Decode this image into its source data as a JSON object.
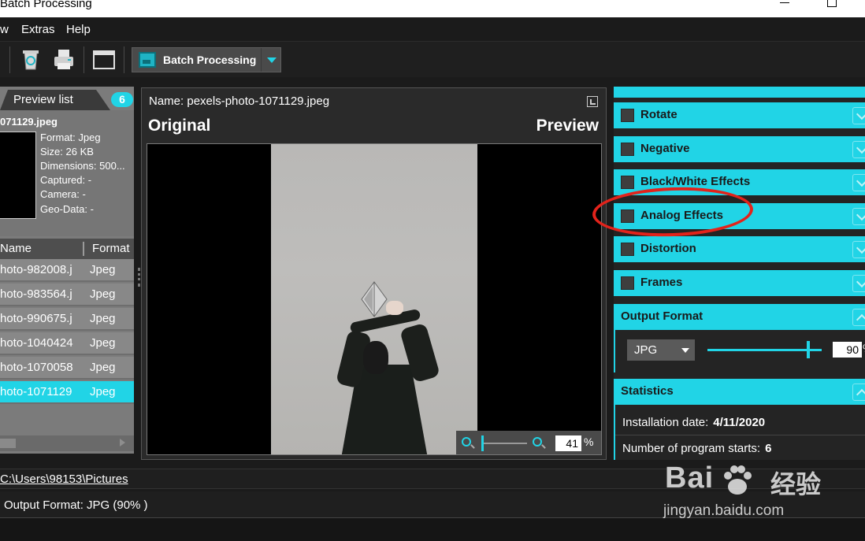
{
  "window": {
    "title": "Batch Processing"
  },
  "menu": [
    {
      "label": "w",
      "x": 0
    },
    {
      "label": "Extras",
      "x": 27
    },
    {
      "label": "Help",
      "x": 84
    }
  ],
  "toolbar": {
    "batch_label": "Batch Processing"
  },
  "preview_list": {
    "tab_label": "Preview list",
    "count": "6",
    "selected_file": "071129.jpeg",
    "meta": {
      "format": "Format: Jpeg",
      "size": "Size: 26 KB",
      "dimensions": "Dimensions: 500...",
      "captured": "Captured: -",
      "camera": "Camera: -",
      "geo": "Geo-Data: -"
    },
    "columns": {
      "name": "Name",
      "format": "Format"
    },
    "rows": [
      {
        "name": "hoto-982008.j",
        "format": "Jpeg"
      },
      {
        "name": "hoto-983564.j",
        "format": "Jpeg"
      },
      {
        "name": "hoto-990675.j",
        "format": "Jpeg"
      },
      {
        "name": "hoto-1040424",
        "format": "Jpeg"
      },
      {
        "name": "hoto-1070058",
        "format": "Jpeg"
      },
      {
        "name": "hoto-1071129",
        "format": "Jpeg"
      }
    ]
  },
  "center": {
    "name_label": "Name: pexels-photo-1071129.jpeg",
    "original_label": "Original",
    "preview_label": "Preview",
    "zoom_value": "41",
    "zoom_unit": "%"
  },
  "effects": {
    "rotate": "Rotate",
    "negative": "Negative",
    "bw": "Black/White Effects",
    "analog": "Analog Effects",
    "distortion": "Distortion",
    "frames": "Frames"
  },
  "output_format": {
    "title": "Output Format",
    "format": "JPG",
    "quality": "90",
    "quality_fraction": 0.9,
    "unit": "%"
  },
  "statistics": {
    "title": "Statistics",
    "install_label": "Installation date:",
    "install_value": "4/11/2020",
    "starts_label": "Number of program starts:",
    "starts_value": "6"
  },
  "status": {
    "path": "C:\\Users\\98153\\Pictures",
    "output": "Output Format: JPG (90% )"
  },
  "watermark": {
    "brand": "Bai",
    "brand2": "经验",
    "url": "jingyan.baidu.com"
  },
  "colors": {
    "accent": "#21d4e6",
    "annotation": "#e3231b"
  }
}
